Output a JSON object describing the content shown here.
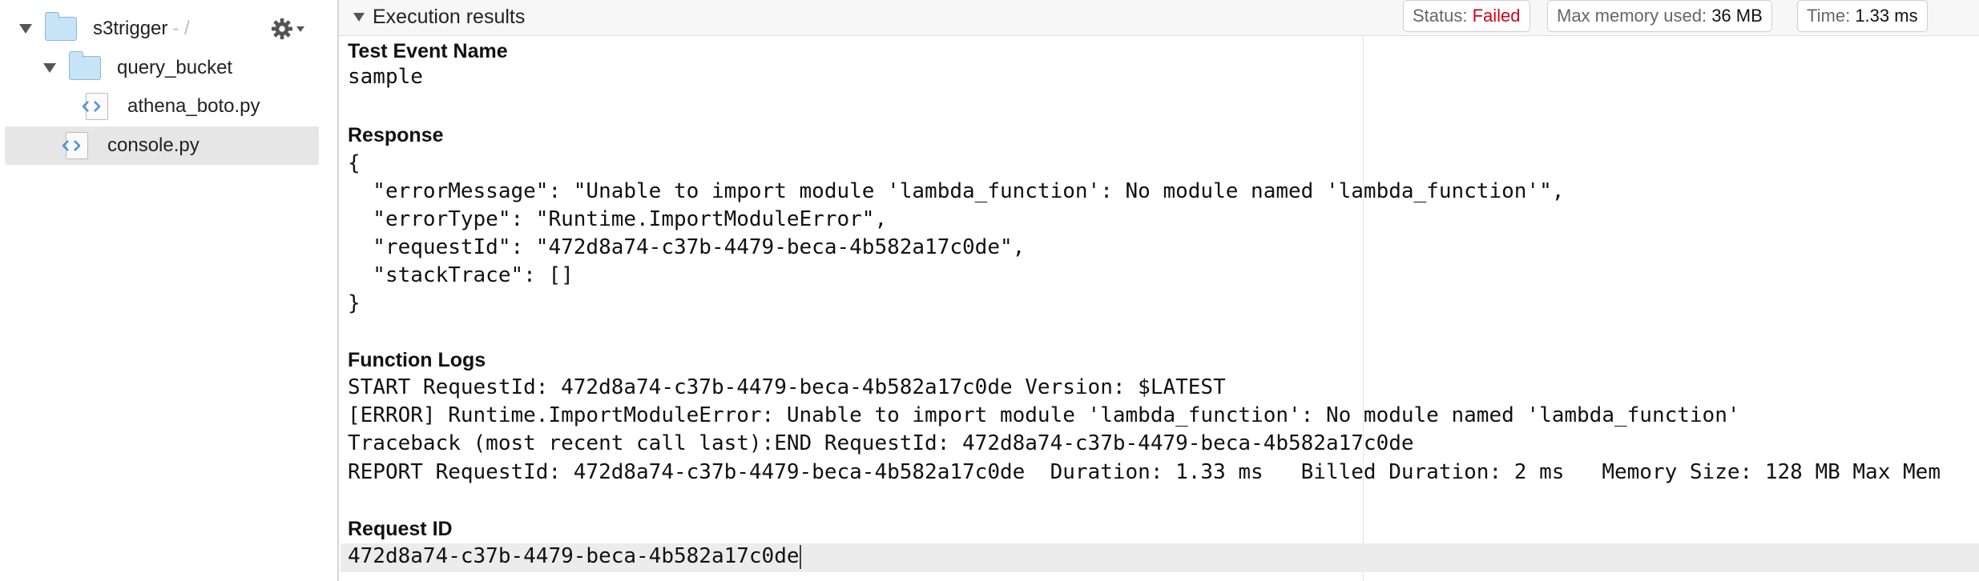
{
  "tree": {
    "root": {
      "name": "s3trigger",
      "suffix": "- /"
    },
    "folder": {
      "name": "query_bucket"
    },
    "files": [
      {
        "name": "athena_boto.py",
        "icon": "python-file-icon"
      },
      {
        "name": "console.py",
        "icon": "python-file-icon",
        "selected": true
      }
    ],
    "settings_icon": "gear-icon"
  },
  "results": {
    "title": "Execution results",
    "status_label": "Status:",
    "status_value": "Failed",
    "memory_label": "Max memory used:",
    "memory_value": "36 MB",
    "time_label": "Time:",
    "time_value": "1.33 ms",
    "colors": {
      "failed": "#d0021b",
      "selection": "#e6e6e6"
    }
  },
  "sections": {
    "test_event": {
      "heading": "Test Event Name",
      "value": "sample"
    },
    "response": {
      "heading": "Response",
      "lines": [
        "{",
        "  \"errorMessage\": \"Unable to import module 'lambda_function': No module named 'lambda_function'\",",
        "  \"errorType\": \"Runtime.ImportModuleError\",",
        "  \"requestId\": \"472d8a74-c37b-4479-beca-4b582a17c0de\",",
        "  \"stackTrace\": []",
        "}"
      ]
    },
    "function_logs": {
      "heading": "Function Logs",
      "lines": [
        "START RequestId: 472d8a74-c37b-4479-beca-4b582a17c0de Version: $LATEST",
        "[ERROR] Runtime.ImportModuleError: Unable to import module 'lambda_function': No module named 'lambda_function'",
        "Traceback (most recent call last):END RequestId: 472d8a74-c37b-4479-beca-4b582a17c0de",
        "REPORT RequestId: 472d8a74-c37b-4479-beca-4b582a17c0de  Duration: 1.33 ms   Billed Duration: 2 ms   Memory Size: 128 MB Max Mem"
      ]
    },
    "request_id": {
      "heading": "Request ID",
      "value": "472d8a74-c37b-4479-beca-4b582a17c0de"
    }
  }
}
